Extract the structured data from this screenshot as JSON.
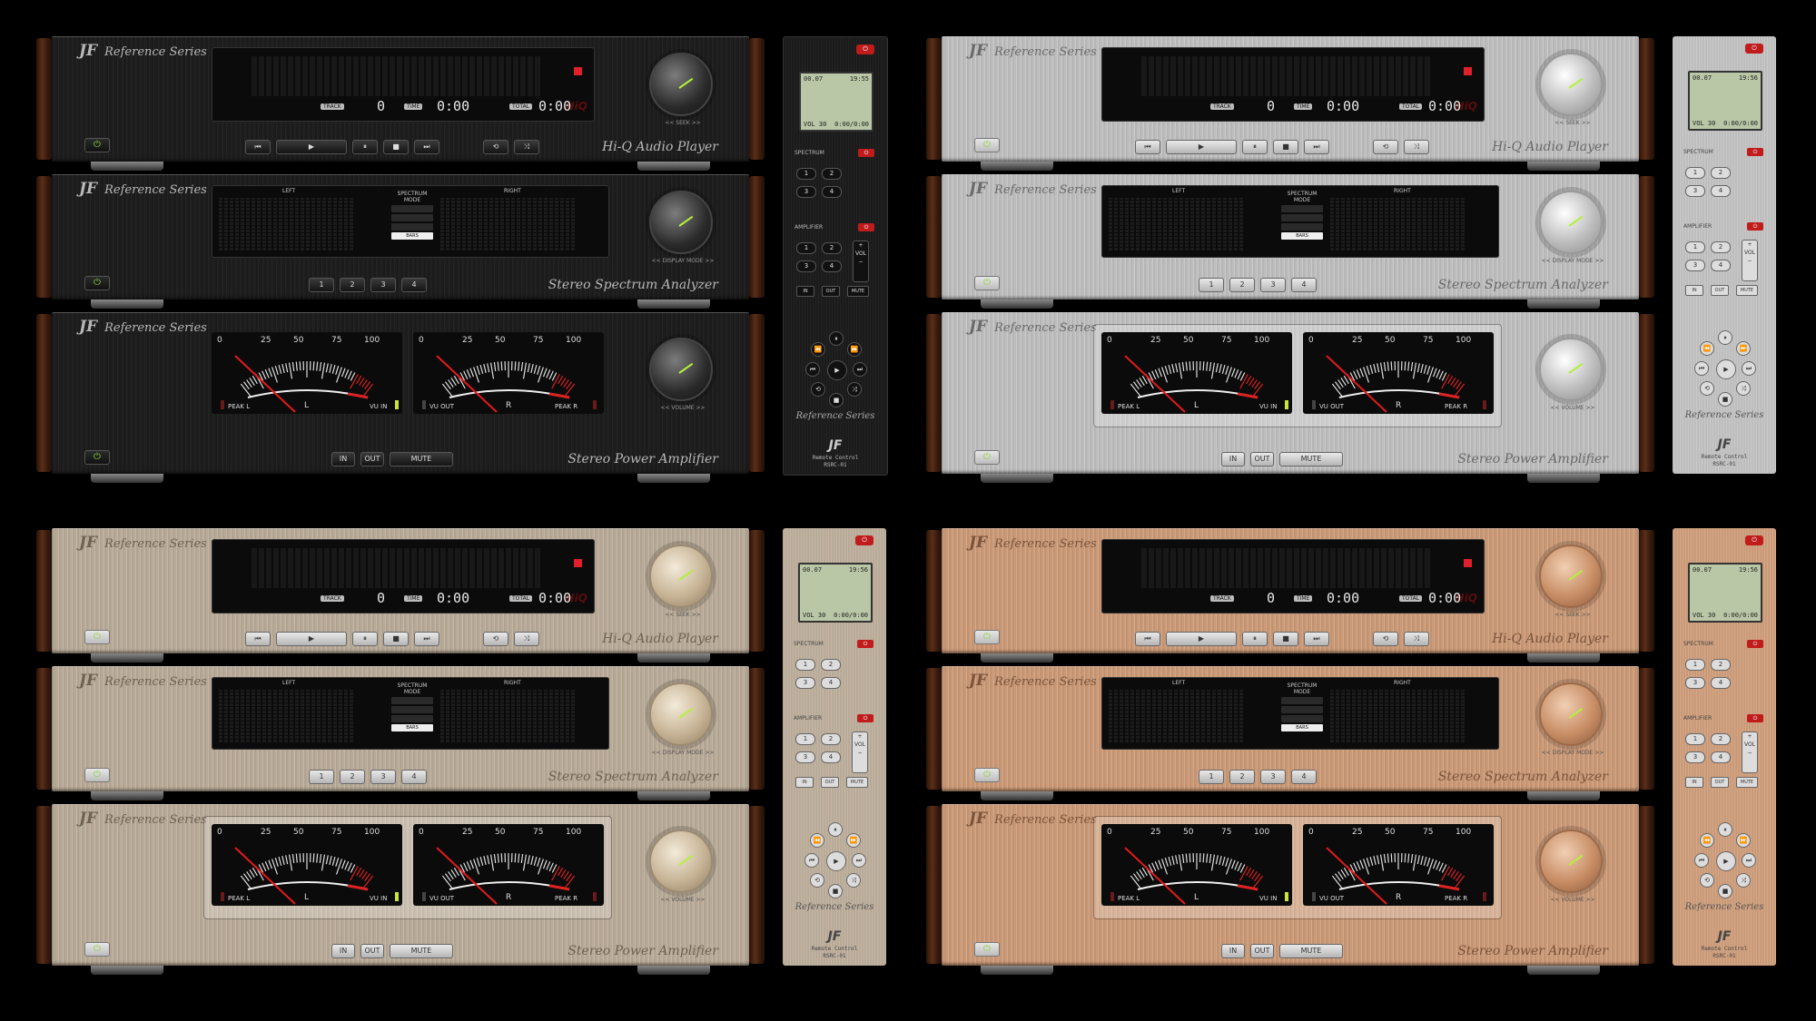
{
  "brand": {
    "logo": "JF",
    "series": "Reference Series"
  },
  "themes": [
    "black",
    "silver",
    "champagne",
    "copper"
  ],
  "player": {
    "model": "Hi-Q Audio Player",
    "knob_label": "<< SEEK >>",
    "track_label": "TRACK",
    "track_value": "0",
    "time_label": "TIME",
    "time_value": "0:00",
    "total_label": "TOTAL",
    "total_value": "0:00",
    "hiq_badge": "HiQ",
    "transport": [
      "⏮",
      "▶",
      "⏸",
      "■",
      "⏭",
      "⟲",
      "⤨"
    ]
  },
  "analyzer": {
    "model": "Stereo Spectrum Analyzer",
    "knob_label": "<< DISPLAY MODE >>",
    "left_label": "LEFT",
    "right_label": "RIGHT",
    "mode_title": "SPECTRUM MODE",
    "modes": [
      "",
      "",
      "",
      "BARS"
    ],
    "selected_mode": "BARS",
    "preset_buttons": [
      "1",
      "2",
      "3",
      "4"
    ]
  },
  "amplifier": {
    "model": "Stereo Power Amplifier",
    "knob_label": "<< VOLUME >>",
    "scale": [
      "0",
      "25",
      "50",
      "75",
      "100"
    ],
    "left_meter": {
      "peak": "PEAK L",
      "channel": "L",
      "vu": "VU IN"
    },
    "right_meter": {
      "vu": "VU OUT",
      "channel": "R",
      "peak": "PEAK R"
    },
    "buttons": [
      "IN",
      "OUT",
      "MUTE"
    ]
  },
  "remote": {
    "lcd_top_left": "00.07",
    "lcd_top_right": "19:55",
    "lcd_top_right_alt": "19:56",
    "lcd_bottom_left": "VOL 30",
    "lcd_bottom_right": "0:00/0:00",
    "spectrum_label": "SPECTRUM",
    "amplifier_label": "AMPLIFIER",
    "num_buttons": [
      "1",
      "2",
      "3",
      "4"
    ],
    "vol_plus": "+",
    "vol_label": "VOL",
    "vol_minus": "−",
    "amp_buttons": [
      "IN",
      "OUT",
      "MUTE"
    ],
    "series": "Reference Series",
    "logo": "JF",
    "model_line1": "Remote Control",
    "model_line2": "RSRC-01"
  }
}
